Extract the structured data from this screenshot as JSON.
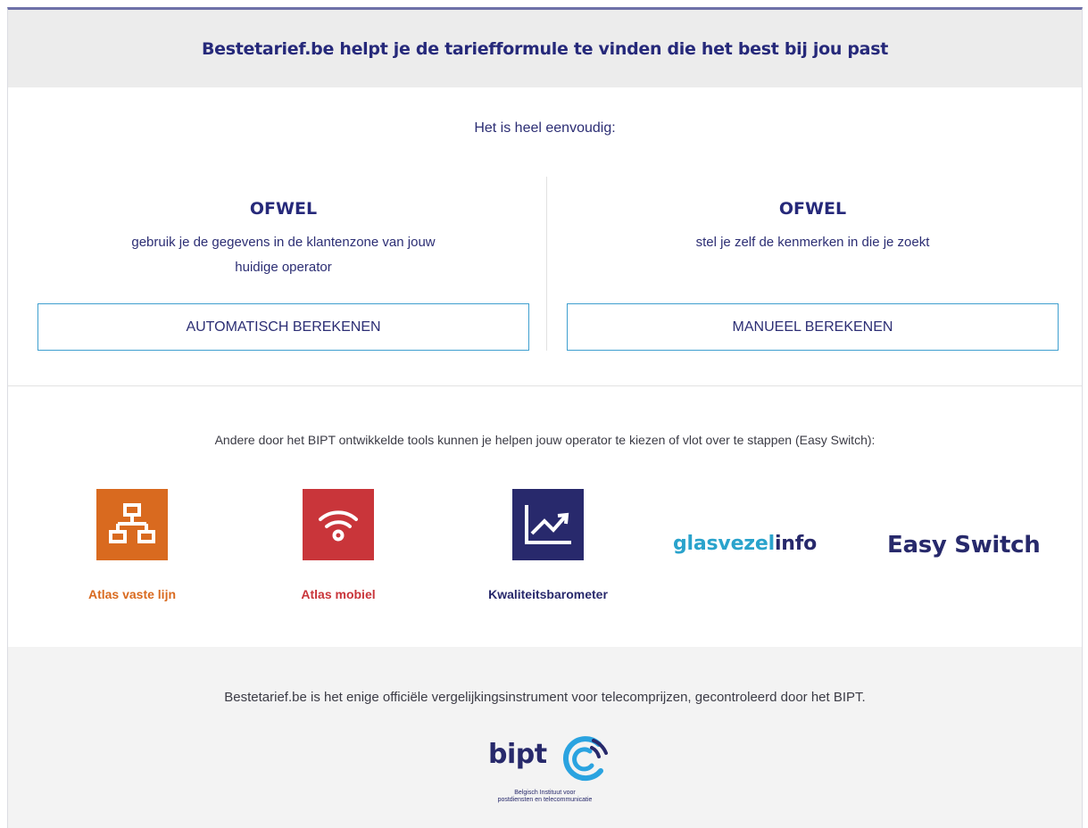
{
  "header": {
    "title": "Bestetarief.be helpt je de tariefformule te vinden die het best bij jou past"
  },
  "intro": "Het is heel eenvoudig:",
  "options": {
    "left": {
      "heading": "OFWEL",
      "description": "gebruik je de gegevens in de klantenzone van jouw huidige operator",
      "button_label": "AUTOMATISCH BEREKENEN"
    },
    "right": {
      "heading": "OFWEL",
      "description": "stel je zelf de kenmerken in die je zoekt",
      "button_label": "MANUEEL BEREKENEN"
    }
  },
  "tools": {
    "intro": "Andere door het BIPT ontwikkelde tools kunnen je helpen jouw operator te kiezen of vlot over te stappen (Easy Switch):",
    "items": [
      {
        "label": "Atlas vaste lijn",
        "icon": "network-icon",
        "color": "#d96a1f"
      },
      {
        "label": "Atlas mobiel",
        "icon": "wifi-icon",
        "color": "#c9353a"
      },
      {
        "label": "Kwaliteitsbarometer",
        "icon": "trend-chart-icon",
        "color": "#28296c"
      }
    ],
    "glasvezel": {
      "part1": "glasvezel",
      "part2": "info"
    },
    "easyswitch": "Easy Switch"
  },
  "footer": {
    "text": "Bestetarief.be is het enige officiële vergelijkingsinstrument voor telecomprijzen, gecontroleerd door het BIPT.",
    "logo_word": "bipt",
    "logo_sub1": "Belgisch Instituut voor",
    "logo_sub2": "postdiensten en telecommunicatie"
  }
}
